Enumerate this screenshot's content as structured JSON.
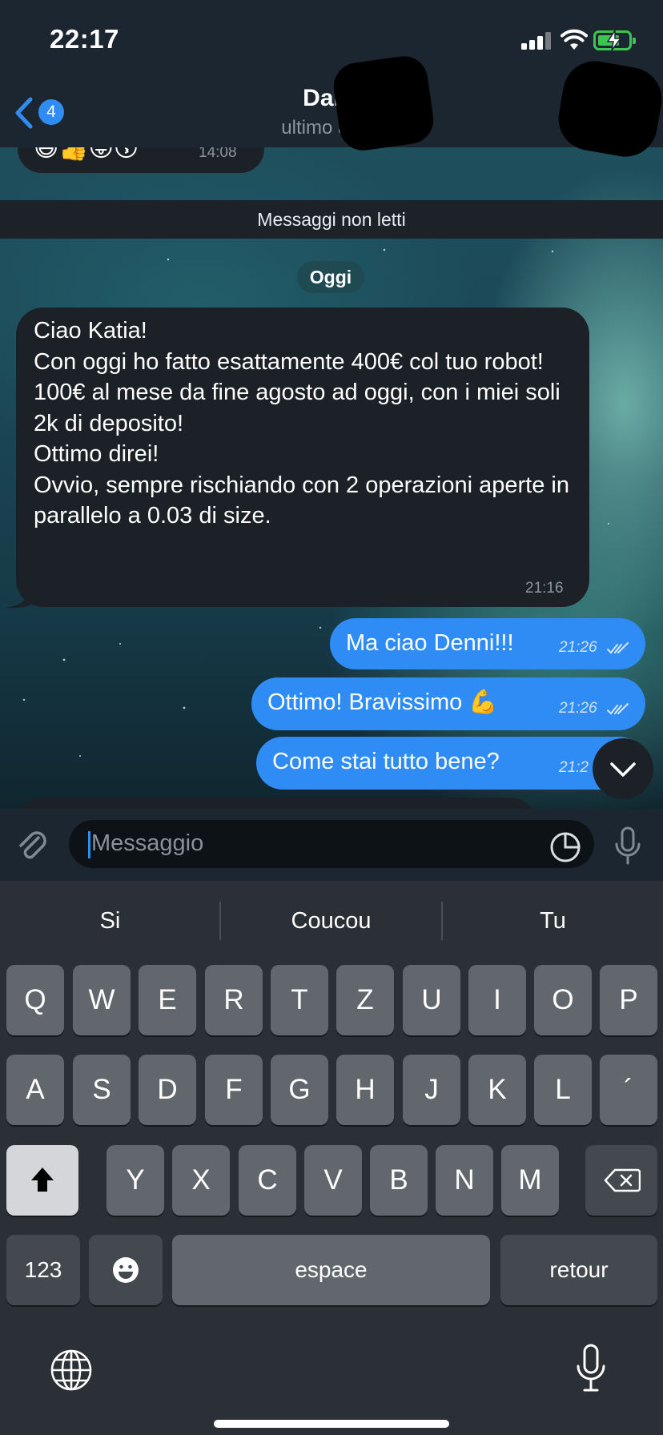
{
  "status_bar": {
    "time": "22:17"
  },
  "header": {
    "back_badge_count": "4",
    "title": "Danny",
    "subtitle": "ultimo access"
  },
  "chat": {
    "previous_message": {
      "emojis": "😅👍😜😗",
      "time": "14:08"
    },
    "unread_divider": "Messaggi non letti",
    "date_label": "Oggi",
    "messages": [
      {
        "direction": "incoming",
        "text": "Ciao Katia!\nCon oggi ho fatto esattamente 400€ col tuo robot!\n100€ al mese da fine agosto ad oggi, con i miei soli 2k di deposito!\nOttimo direi!\nOvvio, sempre rischiando con 2 operazioni aperte in parallelo a 0.03 di size.",
        "time": "21:16"
      },
      {
        "direction": "outgoing",
        "text": "Ma ciao Denni!!!",
        "time": "21:26",
        "status": "read"
      },
      {
        "direction": "outgoing",
        "text": "Ottimo! Bravissimo 💪",
        "time": "21:26",
        "status": "read"
      },
      {
        "direction": "outgoing",
        "text": "Come stai tutto bene?",
        "time": "21:2",
        "status": "read"
      }
    ]
  },
  "composer": {
    "placeholder": "Messaggio"
  },
  "keyboard": {
    "suggestions": [
      "Si",
      "Coucou",
      "Tu"
    ],
    "row1": [
      "Q",
      "W",
      "E",
      "R",
      "T",
      "Z",
      "U",
      "I",
      "O",
      "P"
    ],
    "row2": [
      "A",
      "S",
      "D",
      "F",
      "G",
      "H",
      "J",
      "K",
      "L",
      "´"
    ],
    "row3": [
      "Y",
      "X",
      "C",
      "V",
      "B",
      "N",
      "M"
    ],
    "numbers_key": "123",
    "space_key": "espace",
    "return_key": "retour"
  },
  "colors": {
    "accent": "#2f8cf5",
    "incoming_bubble": "#1b2127",
    "outgoing_bubble": "#2f8cf5",
    "battery": "#3ec551"
  },
  "icons": {
    "back": "chevron-left-icon",
    "attach": "paperclip-icon",
    "sticker": "sticker-icon",
    "mic": "microphone-icon",
    "scroll_down": "chevron-down-icon",
    "globe": "globe-icon",
    "delete": "backspace-icon",
    "shift": "shift-icon",
    "emoji": "emoji-icon"
  }
}
